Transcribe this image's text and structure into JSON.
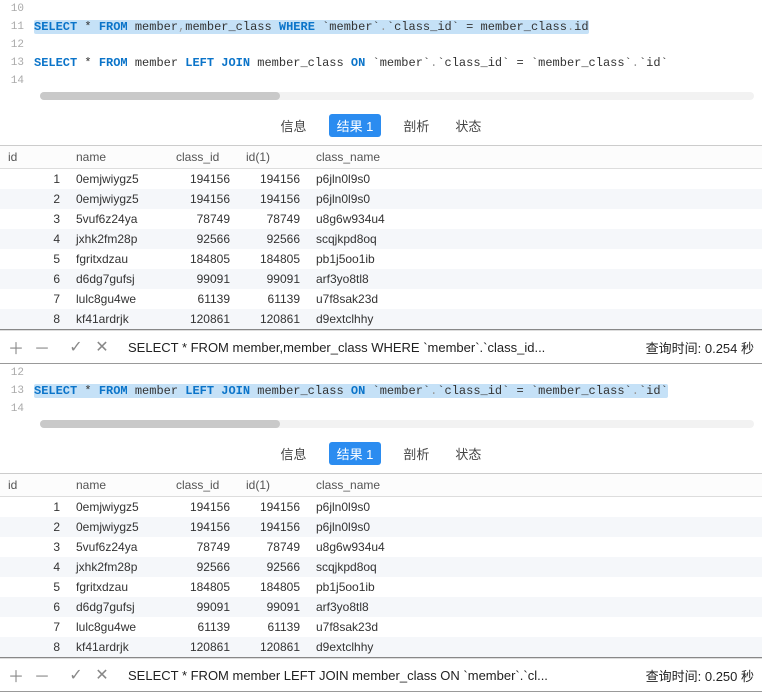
{
  "panels": [
    {
      "editor": {
        "lines": [
          {
            "num": 10,
            "tokens": []
          },
          {
            "num": 11,
            "highlighted": true,
            "tokens": [
              {
                "t": "kw",
                "v": "SELECT"
              },
              {
                "t": "nm",
                "v": " * "
              },
              {
                "t": "kw",
                "v": "FROM"
              },
              {
                "t": "nm",
                "v": " member"
              },
              {
                "t": "punct",
                "v": ","
              },
              {
                "t": "nm",
                "v": "member_class "
              },
              {
                "t": "kw",
                "v": "WHERE"
              },
              {
                "t": "nm",
                "v": " "
              },
              {
                "t": "ticks",
                "v": "`member`"
              },
              {
                "t": "punct",
                "v": "."
              },
              {
                "t": "ticks",
                "v": "`class_id`"
              },
              {
                "t": "nm",
                "v": " = member_class"
              },
              {
                "t": "punct",
                "v": "."
              },
              {
                "t": "nm",
                "v": "id"
              }
            ]
          },
          {
            "num": 12,
            "tokens": []
          },
          {
            "num": 13,
            "tokens": [
              {
                "t": "kw",
                "v": "SELECT"
              },
              {
                "t": "nm",
                "v": " * "
              },
              {
                "t": "kw",
                "v": "FROM"
              },
              {
                "t": "nm",
                "v": " member "
              },
              {
                "t": "kw",
                "v": "LEFT JOIN"
              },
              {
                "t": "nm",
                "v": " member_class "
              },
              {
                "t": "kw",
                "v": "ON"
              },
              {
                "t": "nm",
                "v": " "
              },
              {
                "t": "ticks",
                "v": "`member`"
              },
              {
                "t": "punct",
                "v": "."
              },
              {
                "t": "ticks",
                "v": "`class_id`"
              },
              {
                "t": "nm",
                "v": " = "
              },
              {
                "t": "ticks",
                "v": "`member_class`"
              },
              {
                "t": "punct",
                "v": "."
              },
              {
                "t": "ticks",
                "v": "`id`"
              }
            ]
          },
          {
            "num": 14,
            "tokens": []
          }
        ]
      },
      "status": {
        "statement": "SELECT * FROM member,member_class WHERE `member`.`class_id...",
        "timing_label": "查询时间:",
        "timing_value": "0.254 秒"
      }
    },
    {
      "editor": {
        "lines": [
          {
            "num": 12,
            "tokens": []
          },
          {
            "num": 13,
            "highlighted": true,
            "tokens": [
              {
                "t": "kw",
                "v": "SELECT"
              },
              {
                "t": "nm",
                "v": " * "
              },
              {
                "t": "kw",
                "v": "FROM"
              },
              {
                "t": "nm",
                "v": " member "
              },
              {
                "t": "kw",
                "v": "LEFT JOIN"
              },
              {
                "t": "nm",
                "v": " member_class "
              },
              {
                "t": "kw",
                "v": "ON"
              },
              {
                "t": "nm",
                "v": " "
              },
              {
                "t": "ticks",
                "v": "`member`"
              },
              {
                "t": "punct",
                "v": "."
              },
              {
                "t": "ticks",
                "v": "`class_id`"
              },
              {
                "t": "nm",
                "v": " = "
              },
              {
                "t": "ticks",
                "v": "`member_class`"
              },
              {
                "t": "punct",
                "v": "."
              },
              {
                "t": "ticks",
                "v": "`id`"
              }
            ]
          },
          {
            "num": 14,
            "tokens": []
          }
        ]
      },
      "status": {
        "statement": "SELECT * FROM member LEFT JOIN member_class ON `member`.`cl...",
        "timing_label": "查询时间:",
        "timing_value": "0.250 秒"
      }
    }
  ],
  "tabs": {
    "info": "信息",
    "result": "结果 1",
    "profile": "剖析",
    "status": "状态"
  },
  "grid": {
    "headers": {
      "id": "id",
      "name": "name",
      "class_id": "class_id",
      "id1": "id(1)",
      "class_name": "class_name"
    },
    "rows": [
      {
        "n": 1,
        "name": "0emjwiygz5",
        "class_id": 194156,
        "id1": 194156,
        "class_name": "p6jln0l9s0"
      },
      {
        "n": 2,
        "name": "0emjwiygz5",
        "class_id": 194156,
        "id1": 194156,
        "class_name": "p6jln0l9s0"
      },
      {
        "n": 3,
        "name": "5vuf6z24ya",
        "class_id": 78749,
        "id1": 78749,
        "class_name": "u8g6w934u4"
      },
      {
        "n": 4,
        "name": "jxhk2fm28p",
        "class_id": 92566,
        "id1": 92566,
        "class_name": "scqjkpd8oq"
      },
      {
        "n": 5,
        "name": "fgritxdzau",
        "class_id": 184805,
        "id1": 184805,
        "class_name": "pb1j5oo1ib"
      },
      {
        "n": 6,
        "name": "d6dg7gufsj",
        "class_id": 99091,
        "id1": 99091,
        "class_name": "arf3yo8tl8"
      },
      {
        "n": 7,
        "name": "lulc8gu4we",
        "class_id": 61139,
        "id1": 61139,
        "class_name": "u7f8sak23d"
      },
      {
        "n": 8,
        "name": "kf41ardrjk",
        "class_id": 120861,
        "id1": 120861,
        "class_name": "d9extclhhy"
      }
    ]
  },
  "icons": {
    "add": "＋",
    "remove": "－",
    "apply": "✓",
    "cancel": "✕"
  }
}
